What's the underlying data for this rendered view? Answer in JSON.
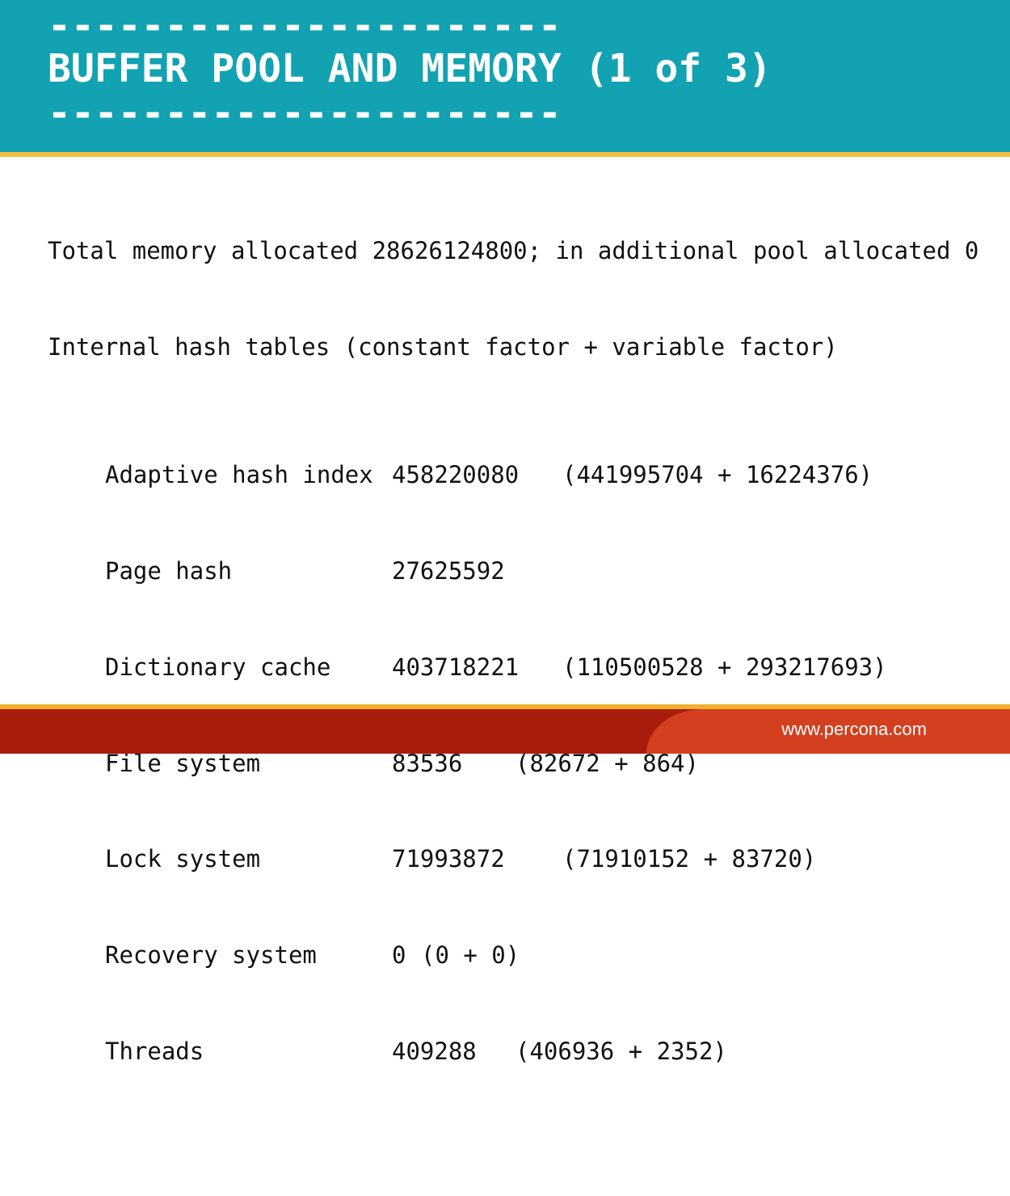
{
  "header": {
    "dash_top": "----------------------",
    "title": "BUFFER POOL AND MEMORY (1 of 3)",
    "dash_bottom": "----------------------"
  },
  "content": {
    "line1": "Total memory allocated 28626124800; in additional pool allocated 0",
    "line2": "Internal hash tables (constant factor + variable factor)",
    "rows": [
      {
        "name": "Adaptive hash index",
        "value": "458220080",
        "detail": "(441995704 + 16224376)"
      },
      {
        "name": "Page hash",
        "value": "27625592",
        "detail": ""
      },
      {
        "name": "Dictionary cache",
        "value": "403718221",
        "detail": "(110500528 + 293217693)"
      },
      {
        "name": "File system",
        "value": "83536",
        "detail": "(82672 + 864)"
      },
      {
        "name": "Lock system",
        "value": "71993872",
        "detail": "(71910152 + 83720)"
      },
      {
        "name": "Recovery system",
        "value": "0",
        "detail": "(0 + 0)"
      },
      {
        "name": "Threads",
        "value": "409288",
        "detail": "(406936 + 2352)"
      }
    ]
  },
  "footer": {
    "url": "www.percona.com"
  },
  "colors": {
    "header_bg": "#12a2b2",
    "header_rule": "#f0c040",
    "footer_bg": "#a91b0d",
    "footer_accent": "#d2401f"
  }
}
